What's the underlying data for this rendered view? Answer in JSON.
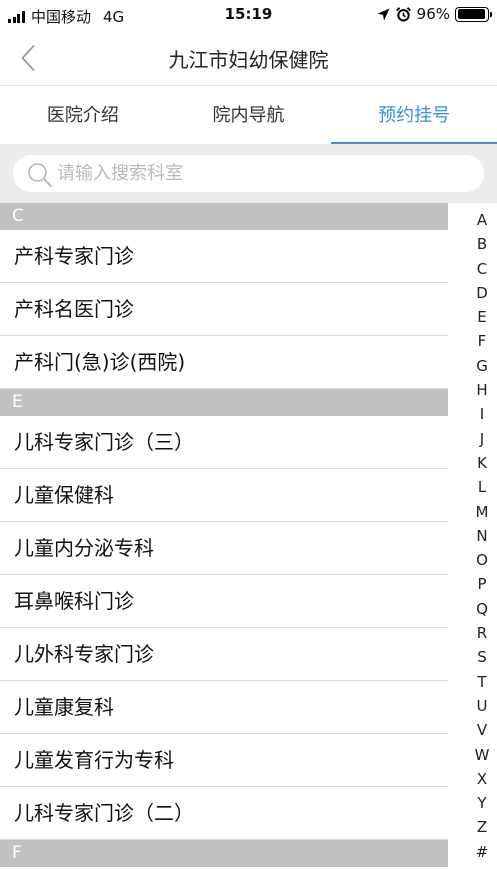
{
  "status_bar": {
    "carrier": "中国移动",
    "network": "4G",
    "time": "15:19",
    "battery_percent": "96%",
    "battery_level": 0.96
  },
  "nav": {
    "title": "九江市妇幼保健院"
  },
  "tabs": [
    {
      "label": "医院介绍"
    },
    {
      "label": "院内导航"
    },
    {
      "label": "预约挂号"
    }
  ],
  "active_tab": 2,
  "search": {
    "placeholder": "请输入搜索科室",
    "value": ""
  },
  "sections": [
    {
      "letter": "C",
      "items": [
        "产科专家门诊",
        "产科名医门诊",
        "产科门(急)诊(西院)"
      ]
    },
    {
      "letter": "E",
      "items": [
        "儿科专家门诊（三）",
        "儿童保健科",
        "儿童内分泌专科",
        "耳鼻喉科门诊",
        "儿外科专家门诊",
        "儿童康复科",
        "儿童发育行为专科",
        "儿科专家门诊（二）"
      ]
    },
    {
      "letter": "F",
      "items": []
    }
  ],
  "index_letters": [
    "A",
    "B",
    "C",
    "D",
    "E",
    "F",
    "G",
    "H",
    "I",
    "J",
    "K",
    "L",
    "M",
    "N",
    "O",
    "P",
    "Q",
    "R",
    "S",
    "T",
    "U",
    "V",
    "W",
    "X",
    "Y",
    "Z",
    "#"
  ],
  "colors": {
    "accent": "#3b8ed8",
    "section_header": "#c2c2c2",
    "search_background": "#ececec"
  }
}
